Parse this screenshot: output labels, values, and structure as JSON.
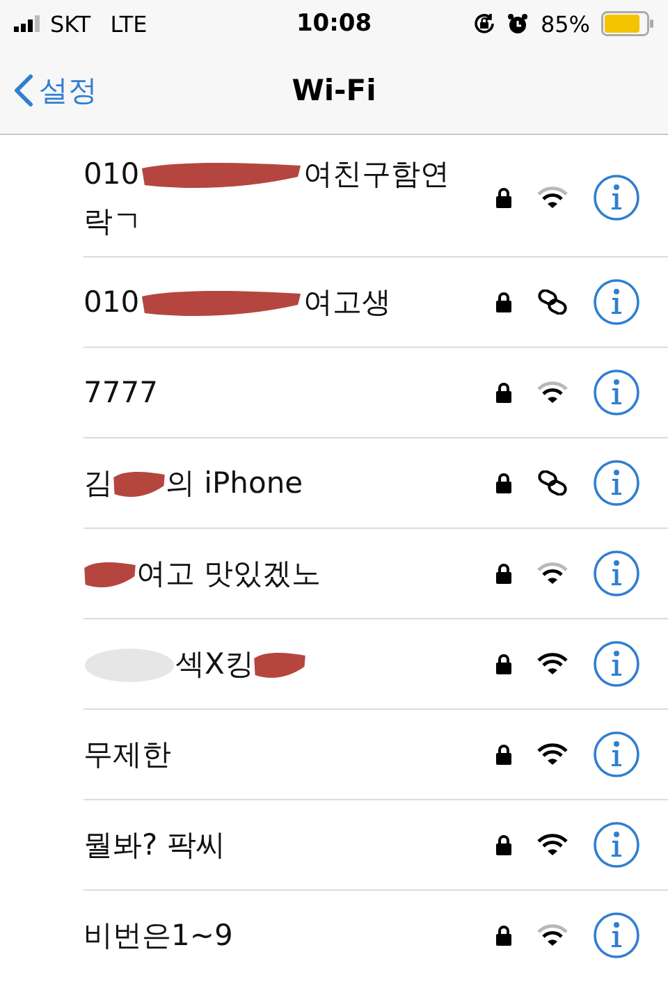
{
  "status_bar": {
    "carrier": "SKT",
    "network": "LTE",
    "time": "10:08",
    "battery": "85%"
  },
  "nav": {
    "back": "설정",
    "title": "Wi-Fi"
  },
  "networks": [
    {
      "kind": "weak",
      "segments": [
        {
          "kind": "text",
          "text": "010"
        },
        {
          "kind": "scribble"
        },
        {
          "kind": "text",
          "text": "여친구함연락ㄱ"
        }
      ]
    },
    {
      "kind": "hotspot",
      "segments": [
        {
          "kind": "text",
          "text": "010"
        },
        {
          "kind": "scribble"
        },
        {
          "kind": "text",
          "text": "여고생"
        }
      ]
    },
    {
      "kind": "weak",
      "segments": [
        {
          "kind": "text",
          "text": "7777"
        }
      ]
    },
    {
      "kind": "hotspot",
      "segments": [
        {
          "kind": "text",
          "text": "김"
        },
        {
          "kind": "blot"
        },
        {
          "kind": "text",
          "text": "의 iPhone"
        }
      ]
    },
    {
      "kind": "weak",
      "segments": [
        {
          "kind": "blot"
        },
        {
          "kind": "text",
          "text": "여고 맛있겠노"
        }
      ]
    },
    {
      "kind": "strong",
      "segments": [
        {
          "kind": "smudge"
        },
        {
          "kind": "text",
          "text": "섹X킹"
        },
        {
          "kind": "blot"
        }
      ]
    },
    {
      "kind": "strong",
      "segments": [
        {
          "kind": "text",
          "text": "무제한"
        }
      ]
    },
    {
      "kind": "strong",
      "segments": [
        {
          "kind": "text",
          "text": "뭘봐? 팍씨"
        }
      ]
    },
    {
      "kind": "weak",
      "segments": [
        {
          "kind": "text",
          "text": "비번은1~9"
        }
      ]
    }
  ]
}
